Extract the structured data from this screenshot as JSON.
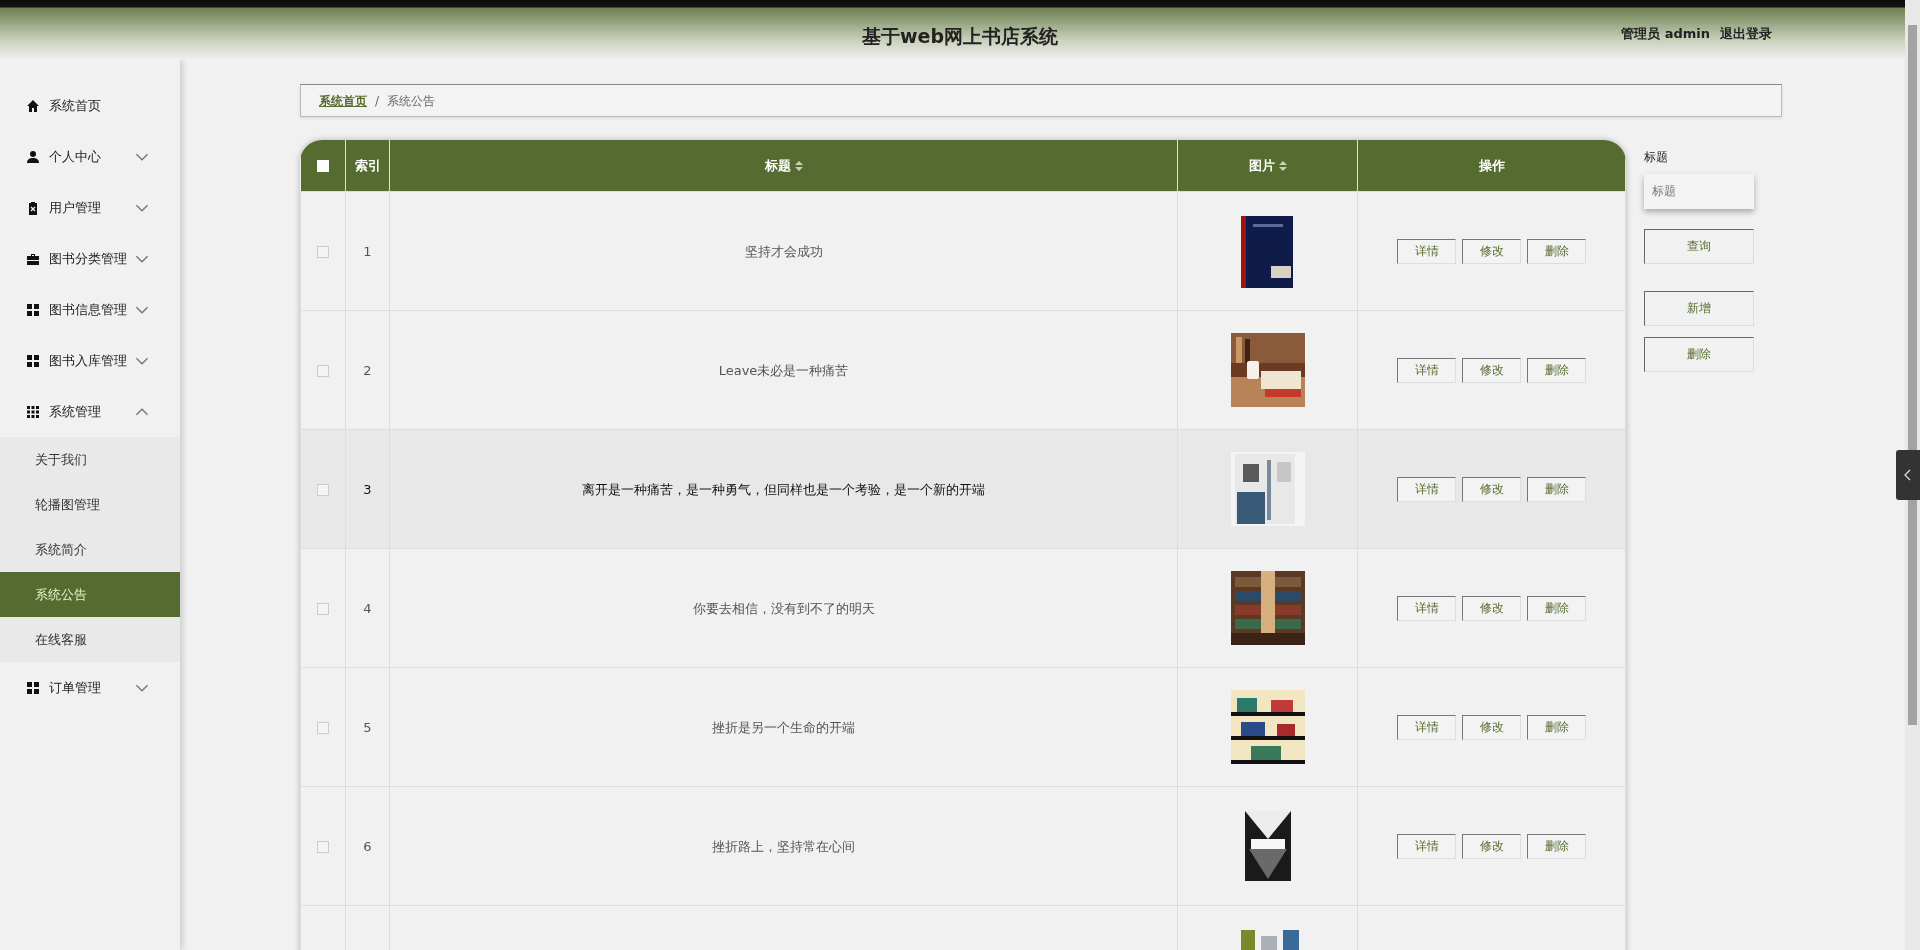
{
  "header": {
    "title": "基于web网上书店系统",
    "user": "管理员 admin",
    "logout": "退出登录"
  },
  "sidebar": {
    "items": [
      {
        "label": "系统首页",
        "selected": false
      },
      {
        "label": "个人中心",
        "expanded": false,
        "selected": false
      },
      {
        "label": "用户管理",
        "expanded": false,
        "selected": false
      },
      {
        "label": "图书分类管理",
        "expanded": false,
        "selected": false
      },
      {
        "label": "图书信息管理",
        "expanded": false,
        "selected": false
      },
      {
        "label": "图书入库管理",
        "expanded": false,
        "selected": false
      },
      {
        "label": "系统管理",
        "expanded": true,
        "selected": false,
        "children": [
          {
            "label": "关于我们",
            "selected": false
          },
          {
            "label": "轮播图管理",
            "selected": false
          },
          {
            "label": "系统简介",
            "selected": false
          },
          {
            "label": "系统公告",
            "selected": true
          },
          {
            "label": "在线客服",
            "selected": false
          }
        ]
      },
      {
        "label": "订单管理",
        "expanded": false,
        "selected": false
      }
    ]
  },
  "breadcrumb": {
    "items": [
      "系统首页",
      "系统公告"
    ],
    "separator": "/"
  },
  "table": {
    "columns": [
      {
        "label": "索引",
        "sortable": false
      },
      {
        "label": "标题",
        "sortable": true
      },
      {
        "label": "图片",
        "sortable": true
      },
      {
        "label": "操作",
        "sortable": false
      }
    ],
    "select_all_checked": false,
    "rows": [
      {
        "index": "1",
        "title": "坚持才会成功",
        "checked": false,
        "hovered": false,
        "picture": {
          "kind": "picture"
        },
        "actions": [
          "详情",
          "修改",
          "删除"
        ]
      },
      {
        "index": "2",
        "title": "Leave未必是一种痛苦",
        "checked": false,
        "hovered": false,
        "picture": {
          "kind": "picture"
        },
        "actions": [
          "详情",
          "修改",
          "删除"
        ]
      },
      {
        "index": "3",
        "title": "离开是一种痛苦，是一种勇气，但同样也是一个考验，是一个新的开端",
        "checked": false,
        "hovered": true,
        "picture": {
          "kind": "picture"
        },
        "actions": [
          "详情",
          "修改",
          "删除"
        ]
      },
      {
        "index": "4",
        "title": "你要去相信，没有到不了的明天",
        "checked": false,
        "hovered": false,
        "picture": {
          "kind": "picture"
        },
        "actions": [
          "详情",
          "修改",
          "删除"
        ]
      },
      {
        "index": "5",
        "title": "挫折是另一个生命的开端",
        "checked": false,
        "hovered": false,
        "picture": {
          "kind": "picture"
        },
        "actions": [
          "详情",
          "修改",
          "删除"
        ]
      },
      {
        "index": "6",
        "title": "挫折路上，坚持常在心间",
        "checked": false,
        "hovered": false,
        "picture": {
          "kind": "picture"
        },
        "actions": [
          "详情",
          "修改",
          "删除"
        ]
      },
      {
        "picture": {
          "kind": "picture"
        }
      }
    ]
  },
  "search": {
    "label": "标题",
    "placeholder": "标题",
    "buttons": [
      "查询",
      "新增",
      "删除"
    ]
  }
}
